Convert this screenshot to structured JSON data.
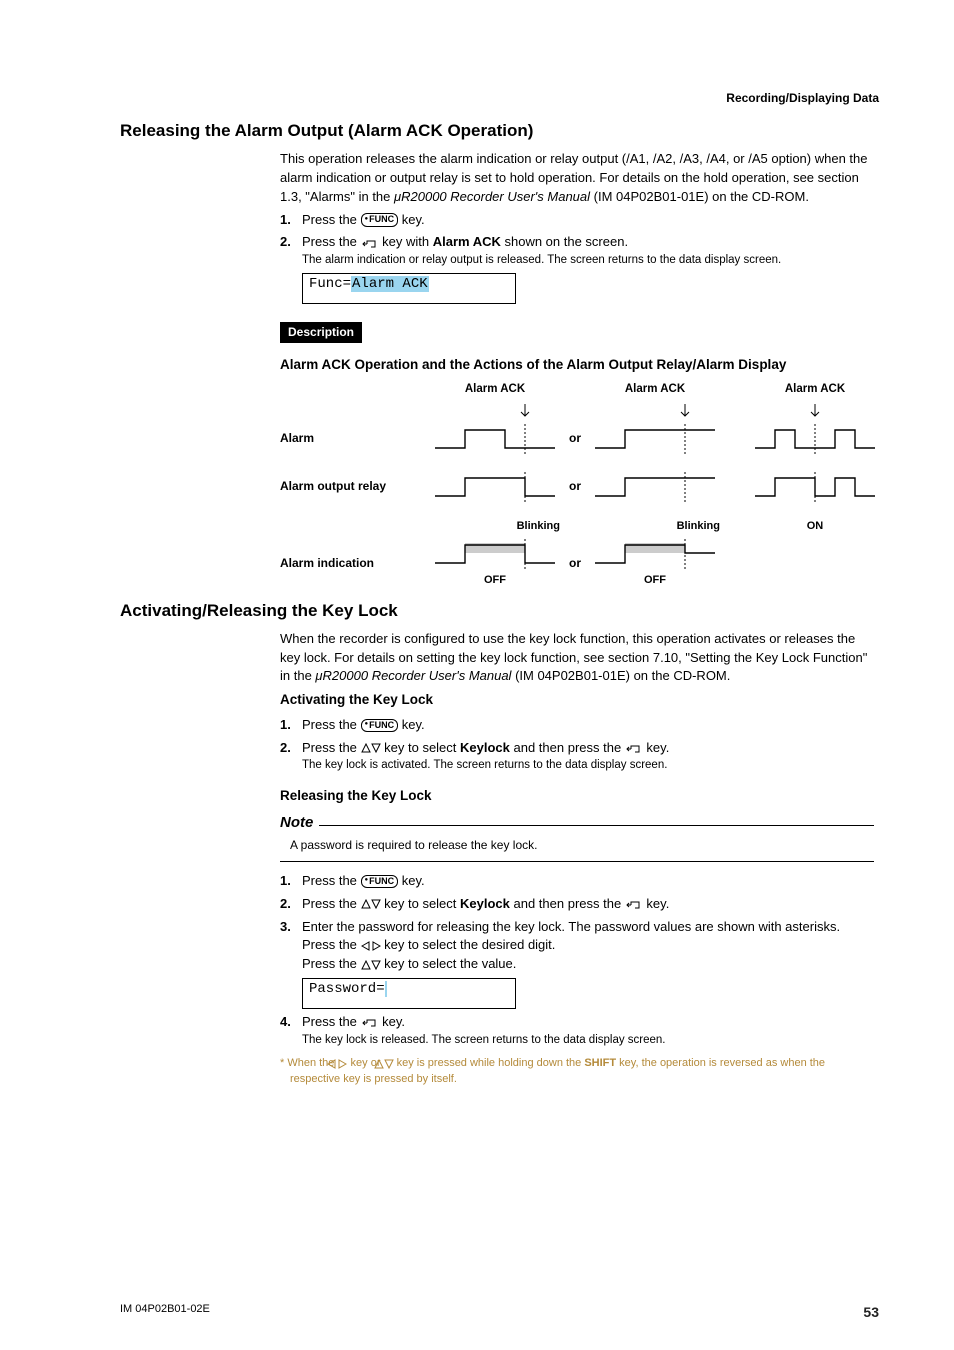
{
  "running_head": "Recording/Displaying Data",
  "section1": {
    "title": "Releasing the Alarm Output (Alarm ACK Operation)",
    "intro_a": "This operation releases the alarm indication or relay output (/A1, /A2,  /A3, /A4, or /A5 option) when the alarm indication or output relay is set to hold operation. For details on the hold operation, see section 1.3, \"Alarms\" in the ",
    "intro_manual": "μR20000 Recorder User's Manual",
    "intro_b": " (IM 04P02B01-01E) on the CD-ROM.",
    "steps": {
      "s1a": "Press the ",
      "s1b": " key.",
      "s2a": "Press the ",
      "s2b": " key with ",
      "s2c": "Alarm ACK",
      "s2d": " shown on the screen.",
      "s2note": "The alarm indication or relay output is released. The screen returns to the data display screen."
    },
    "lcd_prefix": "Func=",
    "lcd_value": "Alarm ACK",
    "desc_label": "Description",
    "desc_title": "Alarm ACK Operation and the Actions of the Alarm Output Relay/Alarm Display",
    "diagram": {
      "ack": "Alarm ACK",
      "rows": {
        "alarm": "Alarm",
        "relay": "Alarm output relay",
        "indication": "Alarm indication"
      },
      "or": "or",
      "blinking": "Blinking",
      "on": "ON",
      "off": "OFF"
    }
  },
  "section2": {
    "title": "Activating/Releasing the Key Lock",
    "intro_a": "When the recorder is configured to use the key lock function, this operation activates or releases the key lock. For details on setting the key lock function, see section 7.10, \"Setting the Key Lock Function\" in the ",
    "intro_manual": "μR20000 Recorder User's Manual",
    "intro_b": " (IM 04P02B01-01E) on the CD-ROM.",
    "activate": {
      "title": "Activating the Key Lock",
      "s1a": "Press the ",
      "s1b": " key.",
      "s2a": "Press the ",
      "s2b": " key to select ",
      "s2c": "Keylock",
      "s2d": " and then press the ",
      "s2e": " key.",
      "s2note": "The key lock is activated. The screen returns to the data display screen."
    },
    "release": {
      "title": "Releasing the Key Lock",
      "note_label": "Note",
      "note_text": "A password is required to release the key lock.",
      "s1a": "Press the ",
      "s1b": " key.",
      "s2a": "Press the ",
      "s2b": " key to select ",
      "s2c": "Keylock",
      "s2d": " and then press the ",
      "s2e": " key.",
      "s3": "Enter the password for releasing the key lock. The password values are shown with asterisks.",
      "s3b_a": "Press the ",
      "s3b_b": " key to select the desired digit.",
      "s3c_a": "Press the ",
      "s3c_b": " key to select the value.",
      "lcd_prefix": "Password=",
      "lcd_value": " ",
      "s4a": "Press the ",
      "s4b": " key.",
      "s4note": "The key lock is released. The screen returns to the data display screen."
    }
  },
  "footnote_a": "*  When the ",
  "footnote_b": " key or ",
  "footnote_c": " key is pressed while holding down the ",
  "footnote_shift": "SHIFT",
  "footnote_d": " key, the operation is reversed as when the respective key is pressed by itself.",
  "footer_doc": "IM 04P02B01-02E",
  "footer_page": "53",
  "icons": {
    "func": "FUNC"
  }
}
